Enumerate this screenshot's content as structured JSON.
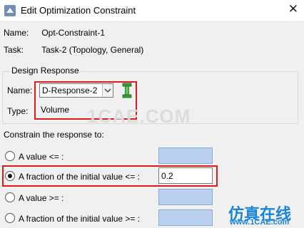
{
  "window": {
    "title": "Edit Optimization Constraint",
    "close_glyph": "✕"
  },
  "name_row": {
    "label": "Name:",
    "value": "Opt-Constraint-1"
  },
  "task_row": {
    "label": "Task:",
    "value": "Task-2 (Topology, General)"
  },
  "design_response": {
    "title": "Design Response",
    "name_label": "Name:",
    "selected": "D-Response-2",
    "type_label": "Type:",
    "type_value": "Volume"
  },
  "constrain": {
    "heading": "Constrain the response to:",
    "options": [
      {
        "label": "A value <= :",
        "selected": false,
        "value": ""
      },
      {
        "label": "A fraction of the initial value <= :",
        "selected": true,
        "value": "0.2"
      },
      {
        "label": "A value >= :",
        "selected": false,
        "value": ""
      },
      {
        "label": "A fraction of the initial value >= :",
        "selected": false,
        "value": ""
      }
    ]
  },
  "watermark": "1CAE.COM",
  "brand": {
    "text": "仿真在线",
    "url": "www.1CAE.com"
  },
  "colors": {
    "highlight": "#e01a1a",
    "disabled_field": "#b9d0ee",
    "brand": "#1a84d6"
  }
}
